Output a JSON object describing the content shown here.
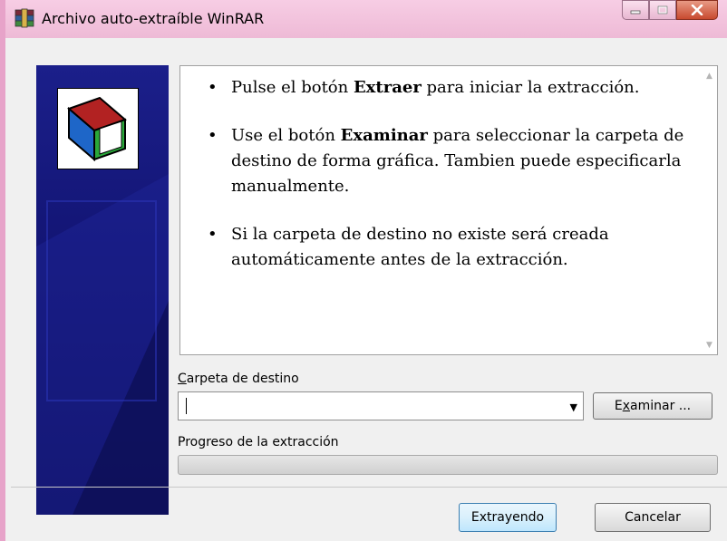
{
  "window": {
    "title": "Archivo auto-extraíble WinRAR",
    "icon": "winrar-icon",
    "titlebar_color": "#f2c2dc",
    "controls": [
      "minimize-icon",
      "maximize-icon",
      "close-icon"
    ]
  },
  "banner": {
    "logo": "winrar-logo",
    "color": "#131575"
  },
  "info": {
    "items": [
      {
        "prefix": "Pulse el botón ",
        "bold": "Extraer",
        "suffix": " para iniciar la extracción."
      },
      {
        "prefix": "Use el botón ",
        "bold": "Examinar",
        "suffix": " para seleccionar la carpeta de destino de forma gráfica. Tambien puede especificarla manualmente."
      },
      {
        "prefix": "Si la carpeta de destino no existe será creada automáticamente antes de la extracción.",
        "bold": "",
        "suffix": ""
      }
    ]
  },
  "destination": {
    "label_accel": "C",
    "label_rest": "arpeta de destino",
    "value": ""
  },
  "browse_button": {
    "pre": "E",
    "accel": "x",
    "post": "aminar ..."
  },
  "progress": {
    "label": "Progreso de la extracción",
    "value": 0
  },
  "buttons": {
    "extract": "Extrayendo",
    "cancel": "Cancelar"
  }
}
